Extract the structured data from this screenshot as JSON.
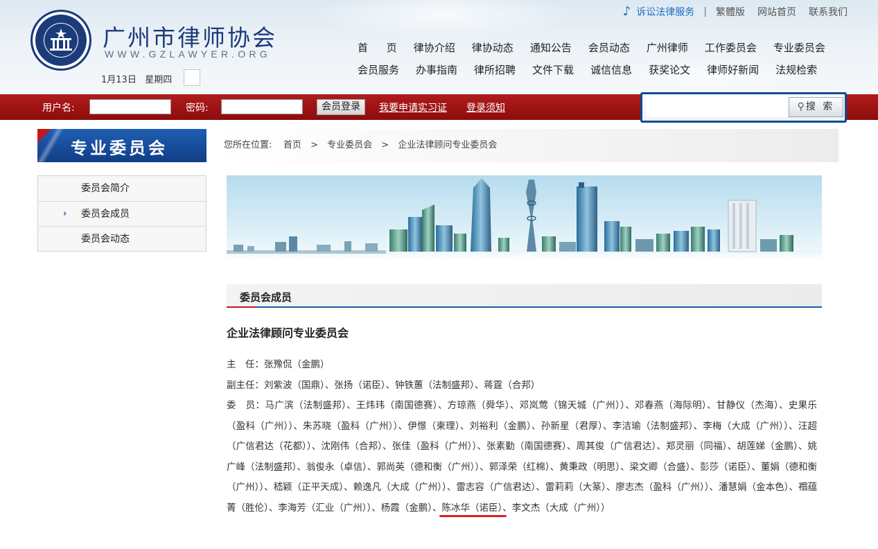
{
  "header": {
    "site_title": "广州市律师协会",
    "site_url": "WWW.GZLAWYER.ORG",
    "date": "1月13日",
    "weekday": "星期四",
    "top_links": {
      "service": "诉讼法律服务",
      "separator": "|",
      "traditional": "繁體版",
      "home": "网站首页",
      "contact": "联系我们"
    },
    "nav_row1": [
      "首 页",
      "律协介绍",
      "律协动态",
      "通知公告",
      "会员动态",
      "广州律师",
      "工作委员会",
      "专业委员会"
    ],
    "nav_row2": [
      "会员服务",
      "办事指南",
      "律所招聘",
      "文件下载",
      "诚信信息",
      "获奖论文",
      "律师好新闻",
      "法规检索"
    ]
  },
  "login": {
    "username_label": "用户名:",
    "password_label": "密码:",
    "login_button": "会员登录",
    "apply_link": "我要申请实习证",
    "notice_link": "登录须知",
    "search_button": "搜 索"
  },
  "sidebar": {
    "banner": "专业委员会",
    "items": [
      {
        "label": "委员会简介",
        "active": false
      },
      {
        "label": "委员会成员",
        "active": true
      },
      {
        "label": "委员会动态",
        "active": false
      }
    ],
    "active_marker": "›"
  },
  "breadcrumb": {
    "prefix": "您所在位置:",
    "items": [
      "首页",
      "专业委员会",
      "企业法律顾问专业委员会"
    ],
    "separator": ">"
  },
  "section": {
    "heading": "委员会成员",
    "title": "企业法律顾问专业委员会",
    "director_label": "主　任：",
    "director": "张豫侃（金鹏）",
    "vice_label": "副主任：",
    "vice": "刘紫波（国鼎）、张扬（诺臣）、钟铁蕙（法制盛邦）、蒋霆（合邦）",
    "members_label": "委　员：",
    "members_main": "马广滨（法制盛邦）、王炜玮（南国德赛）、方琼燕（舜华）、邓岚莺（锦天城（广州））、邓春燕（海际明）、甘静仪（杰海）、史果乐（盈科（广州））、朱苏晓（盈科（广州））、伊憬（柬理）、刘裕利（金鹏）、孙新星（君厚）、李洁瑜（法制盛邦）、李梅（大成（广州））、汪超（广信君达（花都））、沈刚伟（合邦）、张佳（盈科（广州））、张素勤（南国德赛）、周其俊（广信君达）、郑灵丽（同福）、胡莲娣（金鹏）、姚广峰（法制盛邦）、翁俊永（卓信）、郭尚英（德和衡（广州））、郭泽荣（红棉）、黄秉政（明思）、梁文卿（合盛）、彭莎（诺臣）、董娟（德和衡（广州））、嵇颖（正平天成）、赖逸凡（大成（广州））、雷志容（广信君达）、雷莉莉（大篆）、廖志杰（盈科（广州））、潘慧娟（金本色）、禤蕴菁（胜伦）、李海芳（汇业（广州））、杨霞（金鹏）、",
    "members_highlight": "陈冰华（诺臣）",
    "members_tail": "、李文杰（大成（广州））"
  },
  "colors": {
    "brand_blue": "#1c3b7a",
    "bar_red": "#9e1414",
    "link_blue": "#1b6cc2",
    "highlight_red": "#e02020"
  }
}
